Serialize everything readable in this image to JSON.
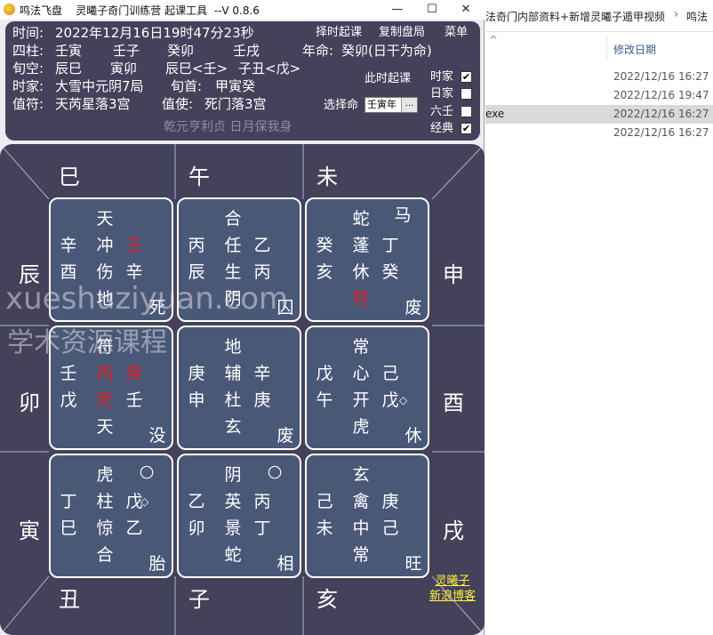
{
  "window": {
    "title": "鸣法飞盘    灵曦子奇门训练营 起课工具  --V 0.8.6",
    "min_symbol": "—",
    "max_symbol": "☐",
    "close_symbol": "✕"
  },
  "info": {
    "time_label": "时间:",
    "time_value": "2022年12月16日19时47分23秒",
    "pillars_label": "四柱:",
    "pillars": [
      "壬寅",
      "壬子",
      "癸卯",
      "壬戌"
    ],
    "ming_label": "年命:",
    "ming_value": "癸卯(日干为命)",
    "xunkong_label": "旬空:",
    "xunkong": [
      "辰巳",
      "寅卯",
      "辰巳<壬>",
      "子丑<戊>"
    ],
    "shijia_label": "时家:",
    "shijia_value": "大雪中元阴7局",
    "xunshou_label": "旬首:",
    "xunshou_value": "甲寅癸",
    "zhifu_label": "值符:",
    "zhifu_value": "天芮星落3宫",
    "zhishi_label": "值使:",
    "zhishi_value": "死门落3宫",
    "motto": "乾元亨利贞 日月保我身"
  },
  "actions": {
    "zeshi": "择时起课",
    "copy": "复制盘局",
    "menu": "菜单",
    "cishi": "此时起课",
    "select_ming": "选择命",
    "combo_value": "壬寅年",
    "combo_button": "..."
  },
  "options": [
    {
      "label": "时家",
      "checked": "✔"
    },
    {
      "label": "日家",
      "checked": ""
    },
    {
      "label": "六壬",
      "checked": ""
    },
    {
      "label": "经典",
      "checked": "✔"
    }
  ],
  "branches": {
    "si": "巳",
    "wu": "午",
    "wei": "未",
    "chen": "辰",
    "shen": "申",
    "mao": "卯",
    "you": "酉",
    "yin": "寅",
    "xu": "戌",
    "chou": "丑",
    "zi": "子",
    "hai": "亥"
  },
  "palaces": [
    {
      "cells": {
        "shen": "天",
        "sp": "",
        "hg": "辛",
        "xing": "冲",
        "tg": "壬",
        "hg2": "酉",
        "men": "伤",
        "tg2": "辛",
        "god": "地",
        "state": "死",
        "xing_mark": "",
        "tg_mark": ""
      },
      "red": [
        "tg"
      ]
    },
    {
      "cells": {
        "shen": "合",
        "sp": "",
        "hg": "丙",
        "xing": "任",
        "tg": "乙",
        "hg2": "辰",
        "men": "生",
        "tg2": "丙",
        "god": "阴",
        "state": "囚",
        "xing_mark": "",
        "tg_mark": ""
      },
      "red": []
    },
    {
      "cells": {
        "shen": "蛇",
        "sp": "马",
        "hg": "癸",
        "xing": "蓬",
        "tg": "丁",
        "hg2": "亥",
        "men": "休",
        "tg2": "癸",
        "god": "符",
        "state": "废",
        "xing_mark": "",
        "tg_mark": ""
      },
      "red": [
        "god"
      ]
    },
    {
      "cells": {
        "shen": "符",
        "sp": "",
        "hg": "壬",
        "xing": "丙",
        "tg": "癸",
        "hg2": "戊",
        "men": "死",
        "tg2": "壬",
        "god": "天",
        "state": "没",
        "xing_mark": "",
        "tg_mark": ""
      },
      "red": [
        "xing",
        "tg",
        "men"
      ]
    },
    {
      "cells": {
        "shen": "地",
        "sp": "",
        "hg": "庚",
        "xing": "辅",
        "tg": "辛",
        "hg2": "申",
        "men": "杜",
        "tg2": "庚",
        "god": "玄",
        "state": "废",
        "xing_mark": "",
        "tg_mark": ""
      },
      "red": []
    },
    {
      "cells": {
        "shen": "常",
        "sp": "",
        "hg": "戊",
        "xing": "心",
        "tg": "己",
        "hg2": "午",
        "men": "开",
        "tg2": "戊",
        "god": "虎",
        "state": "休",
        "xing_mark": "",
        "tg_mark": "◇"
      },
      "red": []
    },
    {
      "cells": {
        "shen": "虎",
        "sp": "○",
        "hg": "丁",
        "xing": "柱",
        "tg": "戊",
        "hg2": "巳",
        "men": "惊",
        "tg2": "乙",
        "god": "合",
        "state": "胎",
        "xing_mark": "◇",
        "tg_mark": ""
      },
      "red": []
    },
    {
      "cells": {
        "shen": "阴",
        "sp": "○",
        "hg": "乙",
        "xing": "英",
        "tg": "丙",
        "hg2": "卯",
        "men": "景",
        "tg2": "丁",
        "god": "蛇",
        "state": "相",
        "xing_mark": "",
        "tg_mark": ""
      },
      "red": []
    },
    {
      "cells": {
        "shen": "玄",
        "sp": "",
        "hg": "己",
        "xing": "禽",
        "tg": "庚",
        "hg2": "未",
        "men": "中",
        "tg2": "己",
        "god": "常",
        "state": "旺",
        "xing_mark": "",
        "tg_mark": ""
      },
      "red": []
    }
  ],
  "signature": [
    "灵曦子",
    "新浪博客"
  ],
  "watermark": {
    "latin": "xueshuziyuan.com",
    "cn": "学术资源课程"
  },
  "explorer": {
    "breadcrumb": "法奇门内部资料+新增灵曦子遁甲视频",
    "breadcrumb_arrow": "›",
    "breadcrumb_next": "鸣法",
    "back_symbol": "^",
    "date_header": "修改日期",
    "rows": [
      {
        "name": "",
        "date": "2022/12/16 16:27"
      },
      {
        "name": "",
        "date": "2022/12/16 19:47"
      },
      {
        "name": "exe",
        "date": "2022/12/16 16:27"
      },
      {
        "name": "",
        "date": "2022/12/16 16:27"
      }
    ]
  }
}
